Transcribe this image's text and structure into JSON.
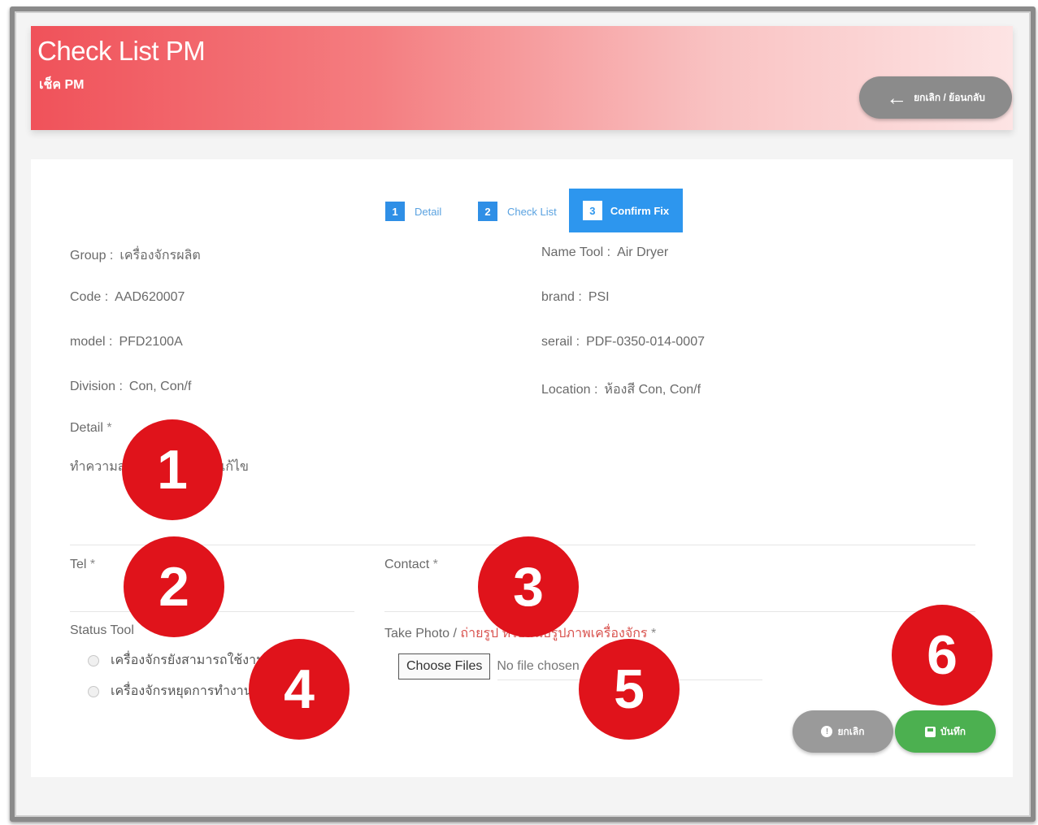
{
  "header": {
    "title": "Check List PM",
    "subtitle": "เช็ค PM",
    "back_button_label": "ยกเลิก / ย้อนกลับ"
  },
  "steps": [
    {
      "number": "1",
      "label": "Detail"
    },
    {
      "number": "2",
      "label": "Check List"
    },
    {
      "number": "3",
      "label": "Confirm Fix"
    }
  ],
  "details": {
    "group_label": "Group :",
    "group_value": "เครื่องจักรผลิต",
    "name_tool_label": "Name Tool :",
    "name_tool_value": "Air Dryer",
    "code_label": "Code :",
    "code_value": "AAD620007",
    "brand_label": "brand :",
    "brand_value": "PSI",
    "model_label": "model :",
    "model_value": "PFD2100A",
    "serial_label": "serail :",
    "serial_value": "PDF-0350-014-0007",
    "division_label": "Division :",
    "division_value": "Con, Con/f",
    "location_label": "Location :",
    "location_value": "ห้องสี Con, Con/f",
    "detail_label": "Detail",
    "detail_value": "ทำความสะอาดเครื่อง ควรแก้ไข"
  },
  "form": {
    "tel_label": "Tel",
    "contact_label": "Contact",
    "required_mark": "*",
    "status_tool_label": "Status Tool",
    "status_options": [
      "เครื่องจักรยังสามารถใช้งานได้",
      "เครื่องจักรหยุดการทำงาน"
    ],
    "take_photo_label": "Take Photo /",
    "take_photo_hint": "ถ่ายรูป หรือแนบรูปภาพเครื่องจักร",
    "choose_files_label": "Choose Files",
    "file_status": "No file chosen"
  },
  "actions": {
    "cancel_label": "ยกเลิก",
    "save_label": "บันทึก"
  },
  "markers": [
    "1",
    "2",
    "3",
    "4",
    "5",
    "6"
  ],
  "colors": {
    "header_start": "#f0525a",
    "header_end": "#fde4e4",
    "step_active": "#2d96ee",
    "marker": "#e0131b",
    "save": "#4cb050",
    "cancel": "#9a9a9a"
  }
}
